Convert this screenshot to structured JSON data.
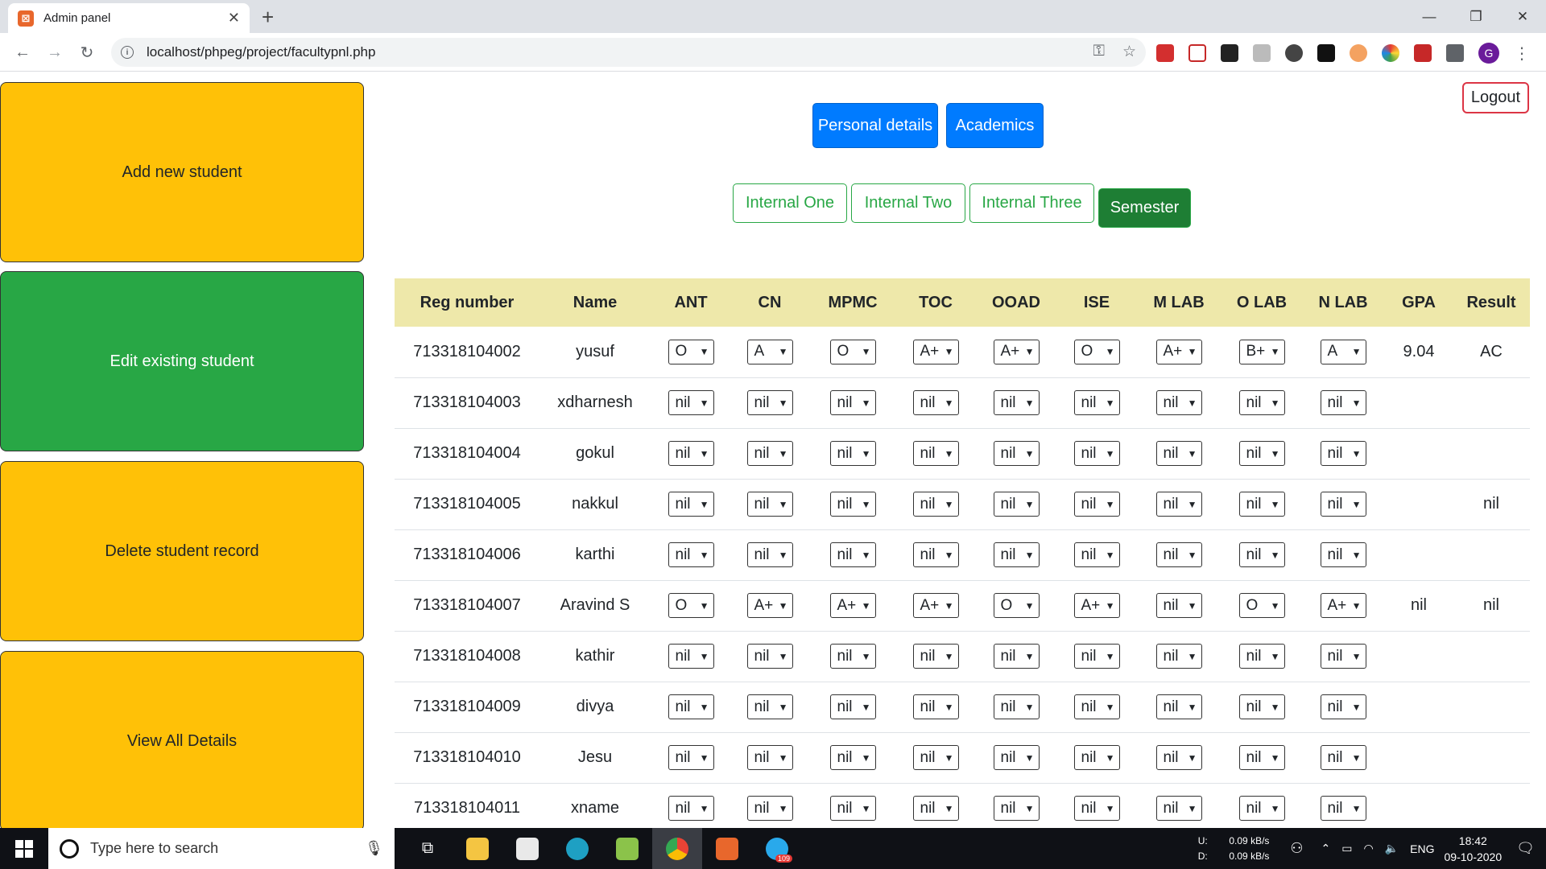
{
  "browser": {
    "tab_title": "Admin panel",
    "tab_favicon": "xampp-icon",
    "url": "localhost/phpeg/project/facultypnl.php",
    "profile_initial": "G"
  },
  "sidebar": {
    "add": "Add new student",
    "edit": "Edit existing student",
    "delete": "Delete student record",
    "view": "View All Details"
  },
  "header": {
    "logout": "Logout",
    "personal": "Personal details",
    "academics": "Academics",
    "internal_one": "Internal One",
    "internal_two": "Internal Two",
    "internal_three": "Internal Three",
    "semester": "Semester"
  },
  "table": {
    "columns": [
      "Reg number",
      "Name",
      "ANT",
      "CN",
      "MPMC",
      "TOC",
      "OOAD",
      "ISE",
      "M LAB",
      "O LAB",
      "N LAB",
      "GPA",
      "Result"
    ],
    "rows": [
      {
        "reg": "713318104002",
        "name": "yusuf",
        "grades": [
          "O",
          "A",
          "O",
          "A+",
          "A+",
          "O",
          "A+",
          "B+",
          "A"
        ],
        "gpa": "9.04",
        "result": "AC"
      },
      {
        "reg": "713318104003",
        "name": "xdharnesh",
        "grades": [
          "nil",
          "nil",
          "nil",
          "nil",
          "nil",
          "nil",
          "nil",
          "nil",
          "nil"
        ],
        "gpa": "",
        "result": ""
      },
      {
        "reg": "713318104004",
        "name": "gokul",
        "grades": [
          "nil",
          "nil",
          "nil",
          "nil",
          "nil",
          "nil",
          "nil",
          "nil",
          "nil"
        ],
        "gpa": "",
        "result": ""
      },
      {
        "reg": "713318104005",
        "name": "nakkul",
        "grades": [
          "nil",
          "nil",
          "nil",
          "nil",
          "nil",
          "nil",
          "nil",
          "nil",
          "nil"
        ],
        "gpa": "",
        "result": "nil"
      },
      {
        "reg": "713318104006",
        "name": "karthi",
        "grades": [
          "nil",
          "nil",
          "nil",
          "nil",
          "nil",
          "nil",
          "nil",
          "nil",
          "nil"
        ],
        "gpa": "",
        "result": ""
      },
      {
        "reg": "713318104007",
        "name": "Aravind S",
        "grades": [
          "O",
          "A+",
          "A+",
          "A+",
          "O",
          "A+",
          "nil",
          "O",
          "A+"
        ],
        "gpa": "nil",
        "result": "nil"
      },
      {
        "reg": "713318104008",
        "name": "kathir",
        "grades": [
          "nil",
          "nil",
          "nil",
          "nil",
          "nil",
          "nil",
          "nil",
          "nil",
          "nil"
        ],
        "gpa": "",
        "result": ""
      },
      {
        "reg": "713318104009",
        "name": "divya",
        "grades": [
          "nil",
          "nil",
          "nil",
          "nil",
          "nil",
          "nil",
          "nil",
          "nil",
          "nil"
        ],
        "gpa": "",
        "result": ""
      },
      {
        "reg": "713318104010",
        "name": "Jesu",
        "grades": [
          "nil",
          "nil",
          "nil",
          "nil",
          "nil",
          "nil",
          "nil",
          "nil",
          "nil"
        ],
        "gpa": "",
        "result": ""
      },
      {
        "reg": "713318104011",
        "name": "xname",
        "grades": [
          "nil",
          "nil",
          "nil",
          "nil",
          "nil",
          "nil",
          "nil",
          "nil",
          "nil"
        ],
        "gpa": "",
        "result": ""
      }
    ]
  },
  "taskbar": {
    "search_placeholder": "Type here to search",
    "net_up_label": "U:",
    "net_down_label": "D:",
    "net_up": "0.09 kB/s",
    "net_down": "0.09 kB/s",
    "lang": "ENG",
    "time": "18:42",
    "date": "09-10-2020",
    "telegram_badge": "109"
  },
  "colors": {
    "yellow": "#ffc107",
    "green": "#28a745",
    "primary": "#007bff",
    "header_bg": "#eee8aa",
    "logout_border": "#dc3545"
  }
}
